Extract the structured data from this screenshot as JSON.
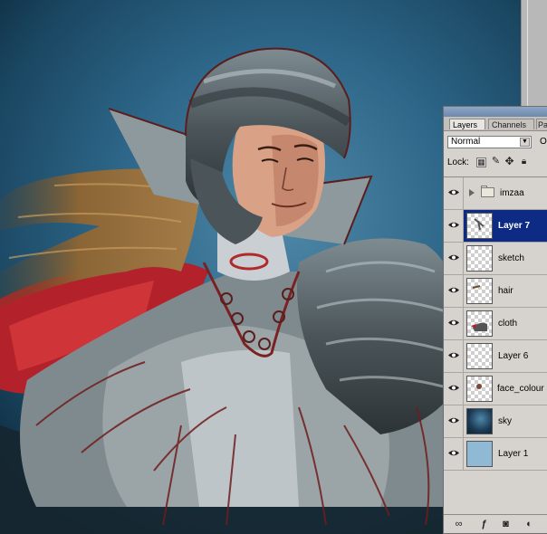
{
  "layers_panel": {
    "tabs": [
      "Layers",
      "Channels",
      "Pa"
    ],
    "blend_mode": "Normal",
    "opacity_label": "O",
    "lock_label": "Lock:",
    "lock_icons": [
      "lock-transparency-icon",
      "lock-paint-icon",
      "lock-move-icon",
      "lock-all-icon"
    ],
    "layers": [
      {
        "name": "imzaa",
        "kind": "group",
        "visible": true,
        "selected": false
      },
      {
        "name": "Layer 7",
        "kind": "layer",
        "visible": true,
        "selected": true
      },
      {
        "name": "sketch",
        "kind": "layer",
        "visible": true,
        "selected": false
      },
      {
        "name": "hair",
        "kind": "layer",
        "visible": true,
        "selected": false
      },
      {
        "name": "cloth",
        "kind": "layer",
        "visible": true,
        "selected": false
      },
      {
        "name": "Layer 6",
        "kind": "layer",
        "visible": true,
        "selected": false
      },
      {
        "name": "face_colour",
        "kind": "layer",
        "visible": true,
        "selected": false
      },
      {
        "name": "sky",
        "kind": "layer",
        "visible": true,
        "selected": false
      },
      {
        "name": "Layer 1",
        "kind": "layer",
        "visible": true,
        "selected": false
      }
    ],
    "footer_icons": [
      "link-icon",
      "layer-style-icon",
      "layer-mask-icon",
      "adjustment-layer-icon"
    ]
  },
  "colors": {
    "selected_row": "#0d2a84",
    "panel_bg": "#d6d3ce",
    "sky_thumb": "#1b3a55",
    "layer1_thumb": "#8fb9d4"
  }
}
